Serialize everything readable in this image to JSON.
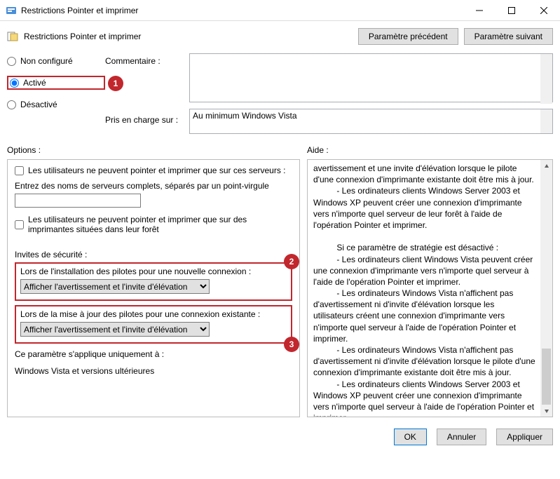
{
  "window": {
    "title": "Restrictions Pointer et imprimer"
  },
  "header": {
    "title": "Restrictions Pointer et imprimer",
    "prev": "Paramètre précédent",
    "next": "Paramètre suivant"
  },
  "state": {
    "not_configured": "Non configuré",
    "enabled": "Activé",
    "disabled": "Désactivé"
  },
  "labels": {
    "comment": "Commentaire :",
    "supported": "Pris en charge sur :",
    "supported_value": "Au minimum Windows Vista",
    "options": "Options :",
    "help": "Aide :"
  },
  "options": {
    "chk1": "Les utilisateurs ne peuvent pointer et imprimer que sur ces serveurs :",
    "hint1": "Entrez des noms de serveurs complets, séparés par un point-virgule",
    "chk2": "Les utilisateurs ne peuvent pointer et imprimer que sur des imprimantes situées dans leur forêt",
    "sec_prompts": "Invites de sécurité :",
    "label_install": "Lors de l'installation des pilotes pour une nouvelle connexion :",
    "label_update": "Lors de la mise à jour des pilotes pour une connexion existante :",
    "dropdown_value": "Afficher l'avertissement et l'invite d'élévation",
    "applies_only": "Ce paramètre s'applique uniquement à :",
    "applies_value": "Windows Vista et versions ultérieures"
  },
  "help_text": "avertissement et une invite d'élévation lorsque le pilote d'une connexion d'imprimante existante doit être mis à jour.\n          - Les ordinateurs clients Windows Server 2003 et Windows XP peuvent créer une connexion d'imprimante vers n'importe quel serveur de leur forêt à l'aide de l'opération Pointer et imprimer.\n\n          Si ce paramètre de stratégie est désactivé :\n          - Les ordinateurs client Windows Vista peuvent créer une connexion d'imprimante vers n'importe quel serveur à l'aide de l'opération Pointer et imprimer.\n          - Les ordinateurs Windows Vista n'affichent pas d'avertissement ni d'invite d'élévation lorsque les utilisateurs créent une connexion d'imprimante vers n'importe quel serveur à l'aide de l'opération Pointer et imprimer.\n          - Les ordinateurs Windows Vista n'affichent pas d'avertissement ni d'invite d'élévation lorsque le pilote d'une connexion d'imprimante existante doit être mis à jour.\n          - Les ordinateurs clients Windows Server 2003 et Windows XP peuvent créer une connexion d'imprimante vers n'importe quel serveur à l'aide de l'opération Pointer et imprimer.\n          - Le paramètre Les utilisateurs peuvent pointer et imprimer vers des ordinateurs de leur forêt uniquement",
  "footer": {
    "ok": "OK",
    "cancel": "Annuler",
    "apply": "Appliquer"
  },
  "callouts": {
    "c1": "1",
    "c2": "2",
    "c3": "3"
  }
}
